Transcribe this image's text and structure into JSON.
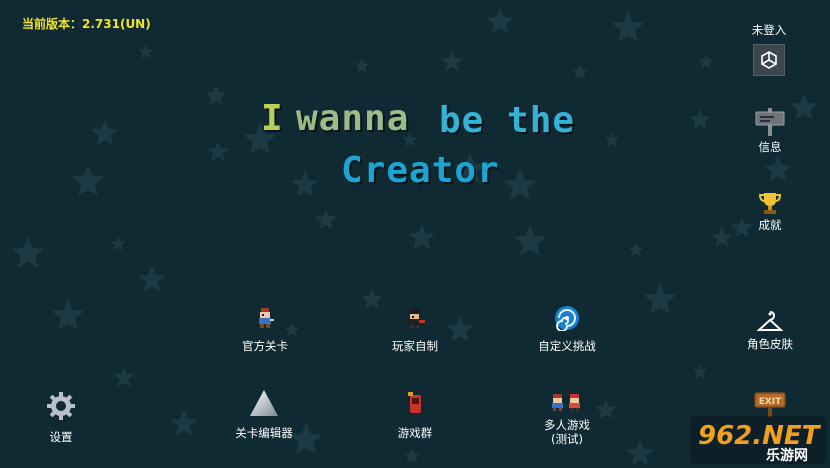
{
  "version": "当前版本：2.731(UN)",
  "title": {
    "part1": "I",
    "part2": "wanna",
    "part3": "be the",
    "part4": "Creator"
  },
  "login": {
    "label": "未登入",
    "icon": "unity-icon"
  },
  "right_menu": [
    {
      "label": "信息",
      "icon": "signboard-icon"
    },
    {
      "label": "成就",
      "icon": "trophy-icon"
    },
    {
      "label": "角色皮肤",
      "icon": "skin-hanger-icon"
    },
    {
      "label": "EXIT",
      "icon": "exit-sign-icon"
    }
  ],
  "main_menu": [
    {
      "label": "官方关卡",
      "icon": "kid-character-icon"
    },
    {
      "label": "玩家自制",
      "icon": "dark-kid-icon"
    },
    {
      "label": "自定义挑战",
      "icon": "swirl-portal-icon"
    },
    {
      "label": "设置",
      "icon": "gear-icon"
    },
    {
      "label": "关卡编辑器",
      "icon": "spike-triangle-icon"
    },
    {
      "label": "游戏群",
      "icon": "red-phone-icon"
    },
    {
      "label": "多人游戏",
      "sublabel": "(测试)",
      "icon": "two-kids-icon"
    }
  ],
  "watermark": {
    "text": "962.NET",
    "subtext": "乐游网"
  },
  "colors": {
    "background": "#0f2a33",
    "version": "#f1e32a",
    "title_blue": "#1ea4d3",
    "title_green": "#9dbb88"
  }
}
